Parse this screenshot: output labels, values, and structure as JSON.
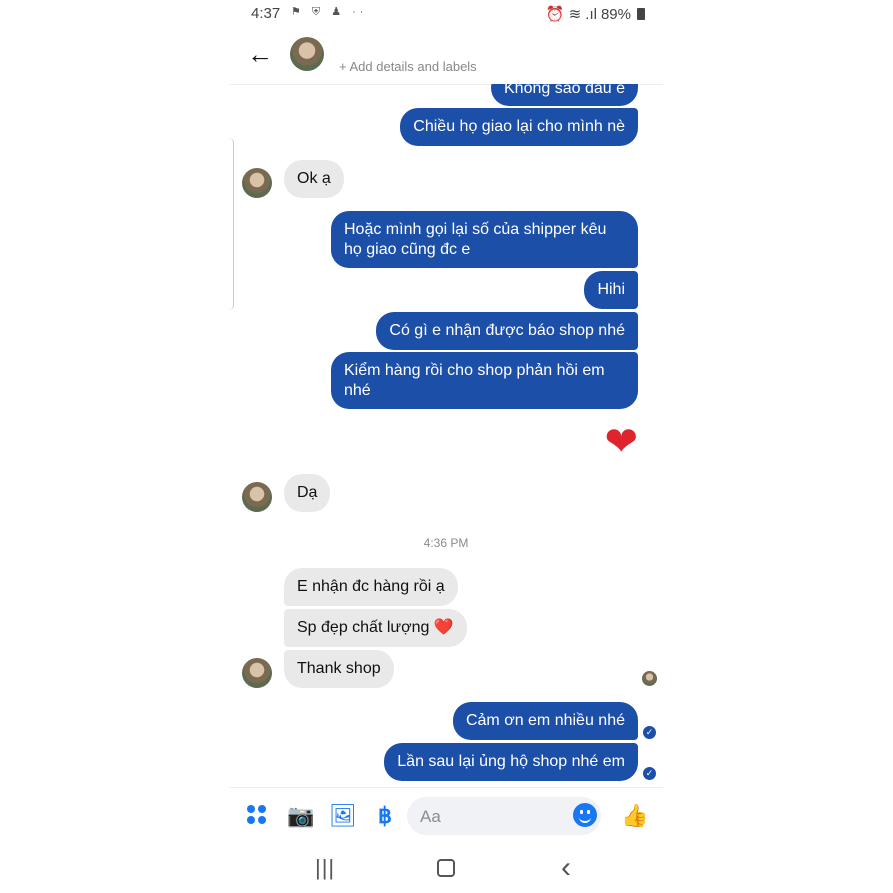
{
  "status": {
    "time": "4:37",
    "icons": "⚑ ⛨ ♟ ··",
    "right_icons": "⏰ ≋ .ıl",
    "battery": "89%"
  },
  "header": {
    "back_icon": "←",
    "details": "+ Add details and labels"
  },
  "messages": {
    "m1": "Không sao đâu e",
    "m2": "Chiều họ giao lại cho mình nè",
    "m3": "Ok ạ",
    "m4": "Hoặc mình gọi lại số của shipper kêu họ giao cũng đc e",
    "m5": "Hihi",
    "m6": "Có gì e nhận được báo shop nhé",
    "m7": "Kiểm hàng rồi cho shop phản hồi em nhé",
    "m8": "❤",
    "m9": "Dạ",
    "timestamp": "4:36 PM",
    "m10": "E nhận đc hàng rồi ạ",
    "m11": "Sp đẹp chất lượng ❤️",
    "m12": "Thank shop",
    "m13": "Cảm ơn em nhiều nhé",
    "m14": "Lần sau lại ủng hộ shop nhé em"
  },
  "composer": {
    "placeholder": "Aa",
    "icons": [
      "apps-icon",
      "camera-icon",
      "gallery-icon",
      "currency-icon",
      "emoji-icon",
      "like-icon"
    ],
    "camera_glyph": "📷",
    "gallery_glyph": "🖼",
    "currency_glyph": "฿",
    "like_glyph": "👍"
  },
  "navbar": {
    "recent": "|||",
    "back": "‹"
  },
  "colors": {
    "outgoing": "#1c4fa8",
    "incoming": "#e9e9ea",
    "accent": "#1877f2"
  }
}
